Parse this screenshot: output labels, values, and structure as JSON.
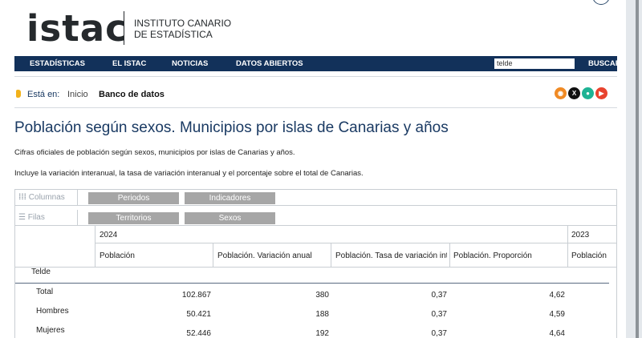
{
  "header": {
    "logo_word": "istac",
    "institute_line1": "INSTITUTO CANARIO",
    "institute_line2": "DE ESTADÍSTICA"
  },
  "nav": {
    "items": [
      "ESTADÍSTICAS",
      "EL ISTAC",
      "NOTICIAS",
      "DATOS ABIERTOS"
    ],
    "search_value": "telde",
    "search_button": "BUSCAR"
  },
  "breadcrumb": {
    "prefix": "Está en:",
    "home": "Inicio",
    "current": "Banco de datos"
  },
  "social_icons": [
    {
      "name": "rss-icon",
      "color": "#f08a24",
      "glyph": "◉"
    },
    {
      "name": "x-icon",
      "color": "#111111",
      "glyph": "X"
    },
    {
      "name": "android-icon",
      "color": "#1db394",
      "glyph": "●"
    },
    {
      "name": "youtube-icon",
      "color": "#e8432e",
      "glyph": "▶"
    }
  ],
  "page": {
    "title": "Población según sexos. Municipios por islas de Canarias y años",
    "desc1": "Cifras oficiales de población según sexos, municipios por islas de Canarias y años.",
    "desc2": "Incluye la variación interanual, la tasa de variación interanual y el porcentaje sobre el total de Canarias."
  },
  "dimensions": {
    "columns_label": "Columnas",
    "rows_label": "Filas",
    "column_chips": [
      "Periodos",
      "Indicadores"
    ],
    "row_chips": [
      "Territorios",
      "Sexos"
    ]
  },
  "table": {
    "year_main": "2024",
    "year_next": "2023",
    "headers": [
      "Población",
      "Población. Variación anual",
      "Población. Tasa de variación interanual",
      "Población. Proporción",
      "Población"
    ],
    "group": "Telde",
    "rows": [
      {
        "label": "Total",
        "values": [
          "102.867",
          "380",
          "0,37",
          "4,62"
        ]
      },
      {
        "label": "Hombres",
        "values": [
          "50.421",
          "188",
          "0,37",
          "4,59"
        ]
      },
      {
        "label": "Mujeres",
        "values": [
          "52.446",
          "192",
          "0,37",
          "4,64"
        ]
      }
    ]
  },
  "colors": {
    "nav_bg": "#12315a",
    "title": "#1a3a63",
    "chip": "#a6a6a6",
    "breadcrumb_bullet": "#f2b21b"
  }
}
